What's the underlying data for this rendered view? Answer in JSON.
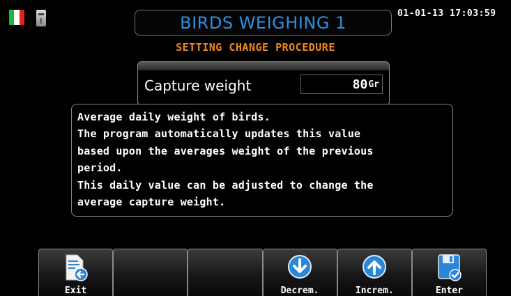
{
  "header": {
    "title": "BIRDS WEIGHING 1",
    "datetime": "01-01-13  17:03:59",
    "language_flag": "italy-flag-icon",
    "usb_icon": "usb-drive-icon"
  },
  "subtitle": "SETTING CHANGE PROCEDURE",
  "setting": {
    "label": "Capture weight",
    "value": "80",
    "unit": "Gr"
  },
  "description": {
    "lines": [
      "Average daily weight of birds.",
      "The program automatically updates this value",
      "based upon the averages weight of the previous",
      "period.",
      "This daily value can be adjusted to change the",
      "average capture weight."
    ]
  },
  "toolbar": {
    "buttons": [
      {
        "label": "Exit",
        "icon": "exit-document-icon"
      },
      {
        "label": "",
        "icon": ""
      },
      {
        "label": "",
        "icon": ""
      },
      {
        "label": "Decrem.",
        "icon": "arrow-down-circle-icon"
      },
      {
        "label": "Increm.",
        "icon": "arrow-up-circle-icon"
      },
      {
        "label": "Enter",
        "icon": "save-disk-icon"
      }
    ]
  },
  "colors": {
    "title": "#2f8fe0",
    "subtitle": "#f08a1a",
    "background": "#000000",
    "icon_blue": "#2a86d6"
  }
}
